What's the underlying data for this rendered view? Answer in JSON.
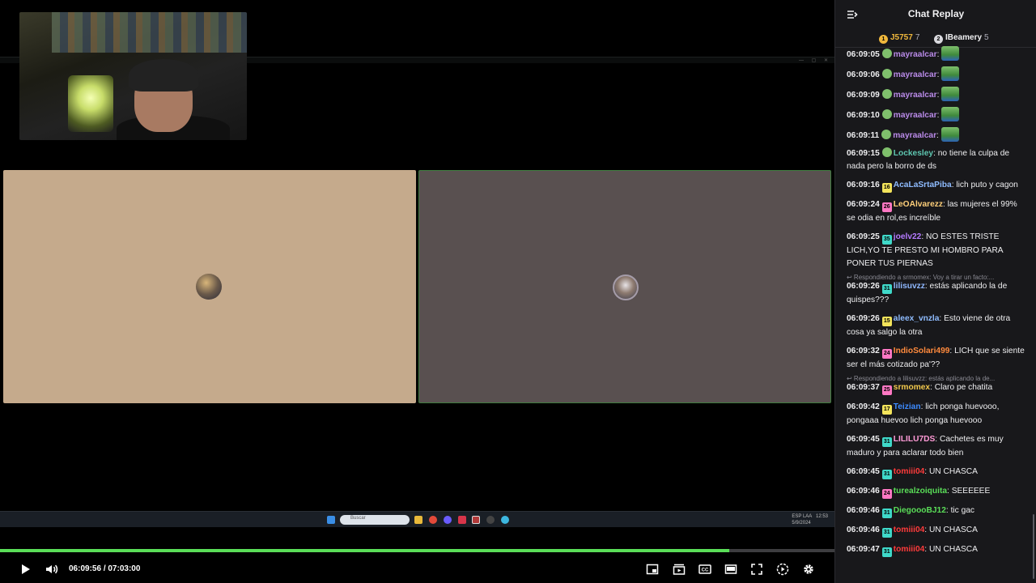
{
  "player": {
    "current_time": "06:09:56",
    "separator": "/",
    "duration": "07:03:00",
    "progress_fraction": 0.874,
    "accent_color": "#5ade58"
  },
  "taskbar": {
    "search_placeholder": "Buscar",
    "tray_lang": "ESP LAA",
    "tray_time": "12:53",
    "tray_date": "5/9/2024"
  },
  "chat": {
    "title": "Chat Replay",
    "leaderboard": [
      {
        "rank": "1",
        "name": "J5757",
        "score": "7",
        "name_color": "#f0b83c"
      },
      {
        "rank": "2",
        "name": "IBeamery",
        "score": "5",
        "name_color": "#efeff1"
      }
    ],
    "messages": [
      {
        "time": "06:09:05",
        "user": "mayraalcar",
        "color": "#b98ae8",
        "text": "",
        "emote": true
      },
      {
        "time": "06:09:06",
        "user": "mayraalcar",
        "color": "#b98ae8",
        "text": "",
        "emote": true
      },
      {
        "time": "06:09:09",
        "user": "mayraalcar",
        "color": "#b98ae8",
        "text": "",
        "emote": true
      },
      {
        "time": "06:09:10",
        "user": "mayraalcar",
        "color": "#b98ae8",
        "text": "",
        "emote": true
      },
      {
        "time": "06:09:11",
        "user": "mayraalcar",
        "color": "#b98ae8",
        "text": "",
        "emote": true
      },
      {
        "time": "06:09:15",
        "user": "Lockesley",
        "color": "#5ec6b0",
        "text": "no tiene la culpa de nada pero la borro de ds"
      },
      {
        "time": "06:09:16",
        "user": "AcaLaSrtaPiba",
        "color": "#8fbcff",
        "text": "lich puto y cagon",
        "badge": "16",
        "badge_color": "#f3e45b"
      },
      {
        "time": "06:09:24",
        "user": "LeOAlvarezz",
        "color": "#ffd07a",
        "text": "las mujeres el 99% se odia en rol,es increíble",
        "badge": "26",
        "badge_color": "#ff78c4"
      },
      {
        "time": "06:09:25",
        "user": "joelv22",
        "color": "#b57bff",
        "text": "NO ESTES TRISTE LICH,YO TE PRESTO MI HOMBRO PARA PONER TUS PIERNAS",
        "badge": "35",
        "badge_color": "#3fd9c9"
      },
      {
        "reply_to": "Respondiendo a srmomex: Voy a tirar un facto:...",
        "time": "06:09:26",
        "user": "lilisuvzz",
        "color": "#8fb8ff",
        "text": "estás aplicando la de quispes???",
        "badge": "31",
        "badge_color": "#3fd9c9"
      },
      {
        "time": "06:09:26",
        "user": "aleex_vnzla",
        "color": "#8fbcff",
        "text": "Esto viene de otra cosa ya salgo la otra",
        "badge": "15",
        "badge_color": "#f3e45b"
      },
      {
        "time": "06:09:32",
        "user": "IndioSolari499",
        "color": "#ff8a3d",
        "text": "LICH que se siente ser el más cotizado pa'??",
        "badge": "24",
        "badge_color": "#ff78c4"
      },
      {
        "reply_to": "Respondiendo a lilisuvzz: estás aplicando la de...",
        "time": "06:09:37",
        "user": "srmomex",
        "color": "#f2c94c",
        "text": "Claro pe chatita",
        "badge": "25",
        "badge_color": "#ff78c4"
      },
      {
        "time": "06:09:42",
        "user": "Teizian",
        "color": "#3d8bff",
        "text": "lich ponga huevooo, pongaaa huevoo lich ponga huevooo",
        "badge": "17",
        "badge_color": "#f3e45b"
      },
      {
        "time": "06:09:45",
        "user": "LILILU7DS",
        "color": "#ff9ad6",
        "text": "Cachetes es muy maduro y para aclarar todo bien",
        "badge": "31",
        "badge_color": "#3fd9c9"
      },
      {
        "time": "06:09:45",
        "user": "tomiii04",
        "color": "#ff3b3b",
        "text": "UN CHASCA",
        "badge": "31",
        "badge_color": "#3fd9c9"
      },
      {
        "time": "06:09:46",
        "user": "turealzoiquita",
        "color": "#5ade58",
        "text": "SEEEEEE",
        "badge": "24",
        "badge_color": "#ff78c4"
      },
      {
        "time": "06:09:46",
        "user": "DiegoooBJ12",
        "color": "#5ade58",
        "text": "tic gac",
        "badge": "31",
        "badge_color": "#3fd9c9"
      },
      {
        "time": "06:09:46",
        "user": "tomiii04",
        "color": "#ff3b3b",
        "text": "UN CHASCA",
        "badge": "31",
        "badge_color": "#3fd9c9"
      },
      {
        "time": "06:09:47",
        "user": "tomiii04",
        "color": "#ff3b3b",
        "text": "UN CHASCA",
        "badge": "31",
        "badge_color": "#3fd9c9"
      }
    ]
  }
}
